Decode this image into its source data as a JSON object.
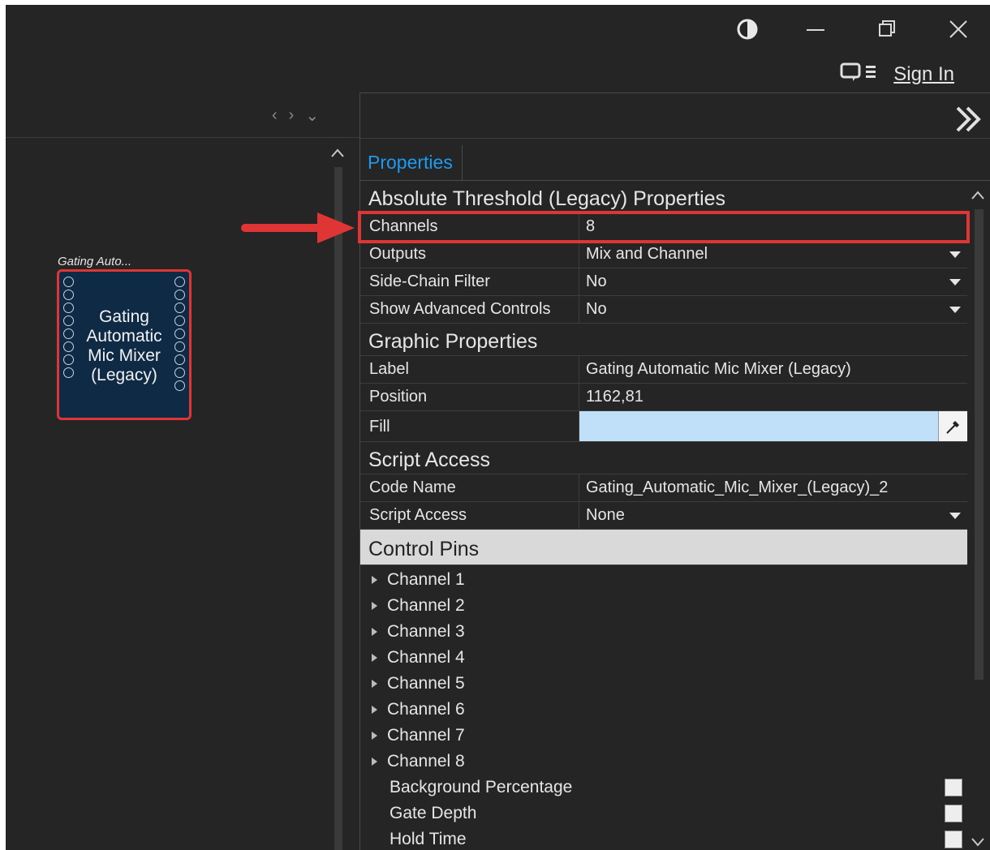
{
  "window": {
    "sign_in_label": "Sign In"
  },
  "canvas": {
    "block_caption": "Gating Auto...",
    "block_title_lines": [
      "Gating",
      "Automatic",
      "Mic Mixer",
      "(Legacy)"
    ],
    "pin_count_left": 8,
    "pin_count_right": 9
  },
  "panel": {
    "tab_label": "Properties",
    "sections": {
      "absolute": {
        "title": "Absolute Threshold (Legacy) Properties",
        "rows": [
          {
            "key": "Channels",
            "value": "8"
          },
          {
            "key": "Outputs",
            "value": "Mix and Channel"
          },
          {
            "key": "Side-Chain Filter",
            "value": "No"
          },
          {
            "key": "Show Advanced Controls",
            "value": "No"
          }
        ]
      },
      "graphic": {
        "title": "Graphic Properties",
        "rows": [
          {
            "key": "Label",
            "value": "Gating Automatic Mic Mixer (Legacy)"
          },
          {
            "key": "Position",
            "value": "1162,81"
          },
          {
            "key": "Fill",
            "value": "",
            "color": "#bfe0f8"
          }
        ]
      },
      "script": {
        "title": "Script Access",
        "rows": [
          {
            "key": "Code Name",
            "value": "Gating_Automatic_Mic_Mixer_(Legacy)_2"
          },
          {
            "key": "Script Access",
            "value": "None"
          }
        ]
      },
      "control_pins": {
        "title": "Control Pins",
        "channels": [
          "Channel 1",
          "Channel 2",
          "Channel 3",
          "Channel 4",
          "Channel 5",
          "Channel 6",
          "Channel 7",
          "Channel 8"
        ],
        "leaves": [
          "Background Percentage",
          "Gate Depth",
          "Hold Time"
        ]
      }
    }
  },
  "colors": {
    "highlight": "#e03535",
    "accent_tab": "#1e9bf0",
    "block_bg": "#0e2a45"
  }
}
